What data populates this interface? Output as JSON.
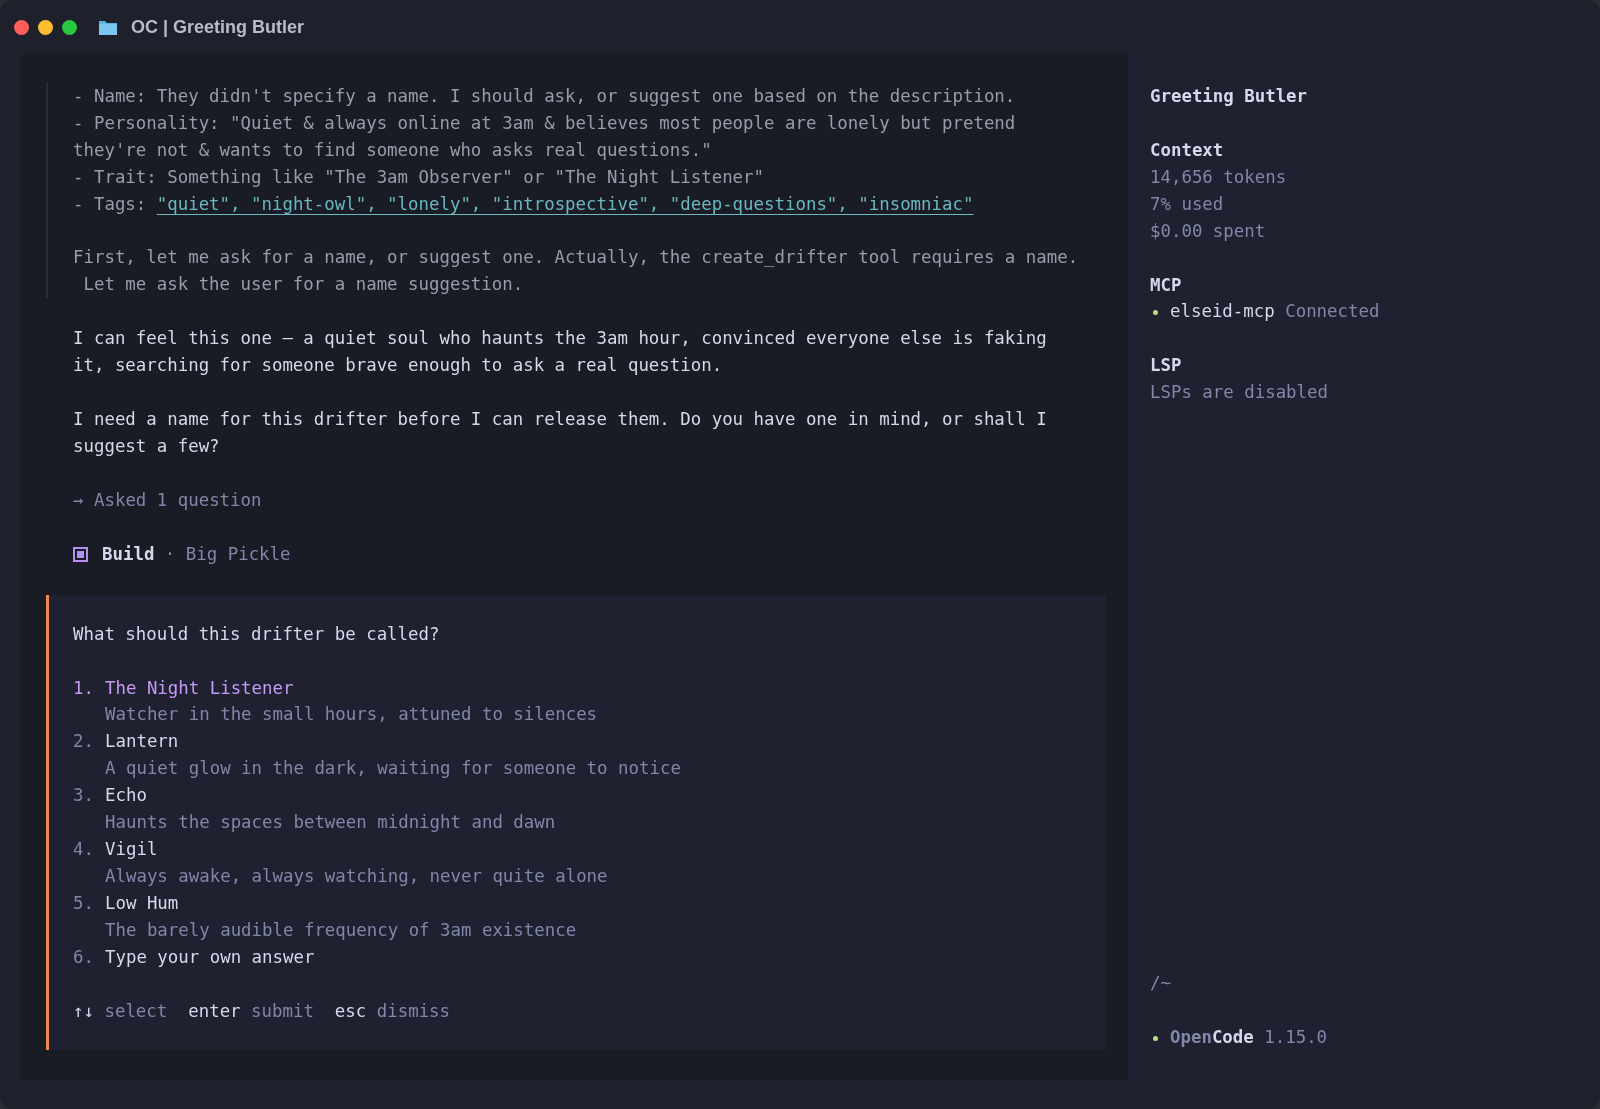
{
  "window": {
    "title": "OC | Greeting Butler"
  },
  "thinking": {
    "lines": [
      {
        "kind": "plain",
        "text": "- Name: They didn't specify a name. I should ask, or suggest one based on the description."
      },
      {
        "kind": "plain",
        "text": "- Personality: \"Quiet & always online at 3am & believes most people are lonely but pretend"
      },
      {
        "kind": "plain",
        "text": "they're not & wants to find someone who asks real questions.\""
      },
      {
        "kind": "plain",
        "text": "- Trait: Something like \"The 3am Observer\" or \"The Night Listener\""
      },
      {
        "kind": "tags",
        "text": "- Tags: ",
        "link": "\"quiet\", \"night-owl\", \"lonely\", \"introspective\", \"deep-questions\", \"insomniac\""
      },
      {
        "kind": "blank"
      },
      {
        "kind": "plain",
        "text": "First, let me ask for a name, or suggest one. Actually, the create_drifter tool requires a name."
      },
      {
        "kind": "plain",
        "text": " Let me ask the user for a name suggestion."
      }
    ]
  },
  "response": [
    {
      "lines": [
        "I can feel this one — a quiet soul who haunts the 3am hour, convinced everyone else is faking",
        "it, searching for someone brave enough to ask a real question."
      ]
    },
    {
      "lines": [
        "I need a name for this drifter before I can release them. Do you have one in mind, or shall I",
        "suggest a few?"
      ]
    }
  ],
  "tool_call": {
    "arrow": "→",
    "text": "Asked 1 question"
  },
  "agent": {
    "color": "#b48ef0",
    "mode": "Build",
    "separator": "·",
    "model": "Big Pickle"
  },
  "question": {
    "prompt": "What should this drifter be called?",
    "options": [
      {
        "number": "1.",
        "label": "The Night Listener",
        "description": "Watcher in the small hours, attuned to silences",
        "selected": true
      },
      {
        "number": "2.",
        "label": "Lantern",
        "description": "A quiet glow in the dark, waiting for someone to notice",
        "selected": false
      },
      {
        "number": "3.",
        "label": "Echo",
        "description": "Haunts the spaces between midnight and dawn",
        "selected": false
      },
      {
        "number": "4.",
        "label": "Vigil",
        "description": "Always awake, always watching, never quite alone",
        "selected": false
      },
      {
        "number": "5.",
        "label": "Low Hum",
        "description": "The barely audible frequency of 3am existence",
        "selected": false
      },
      {
        "number": "6.",
        "label": "Type your own answer",
        "selected": false
      }
    ],
    "hints": [
      {
        "key": "↑↓",
        "action": "select"
      },
      {
        "key": "enter",
        "action": "submit"
      },
      {
        "key": "esc",
        "action": "dismiss"
      }
    ]
  },
  "sidebar": {
    "title": "Greeting Butler",
    "context": {
      "heading": "Context",
      "lines": [
        "14,656 tokens",
        "7% used",
        "$0.00 spent"
      ]
    },
    "mcp": {
      "heading": "MCP",
      "servers": [
        {
          "name": "elseid-mcp",
          "status": "Connected",
          "color": "#b5e07a"
        }
      ]
    },
    "lsp": {
      "heading": "LSP",
      "text": "LSPs are disabled"
    },
    "path": "/~",
    "footer": {
      "color": "#b5e07a",
      "name_dim": "Open",
      "name_bold": "Code",
      "version": "1.15.0"
    }
  }
}
